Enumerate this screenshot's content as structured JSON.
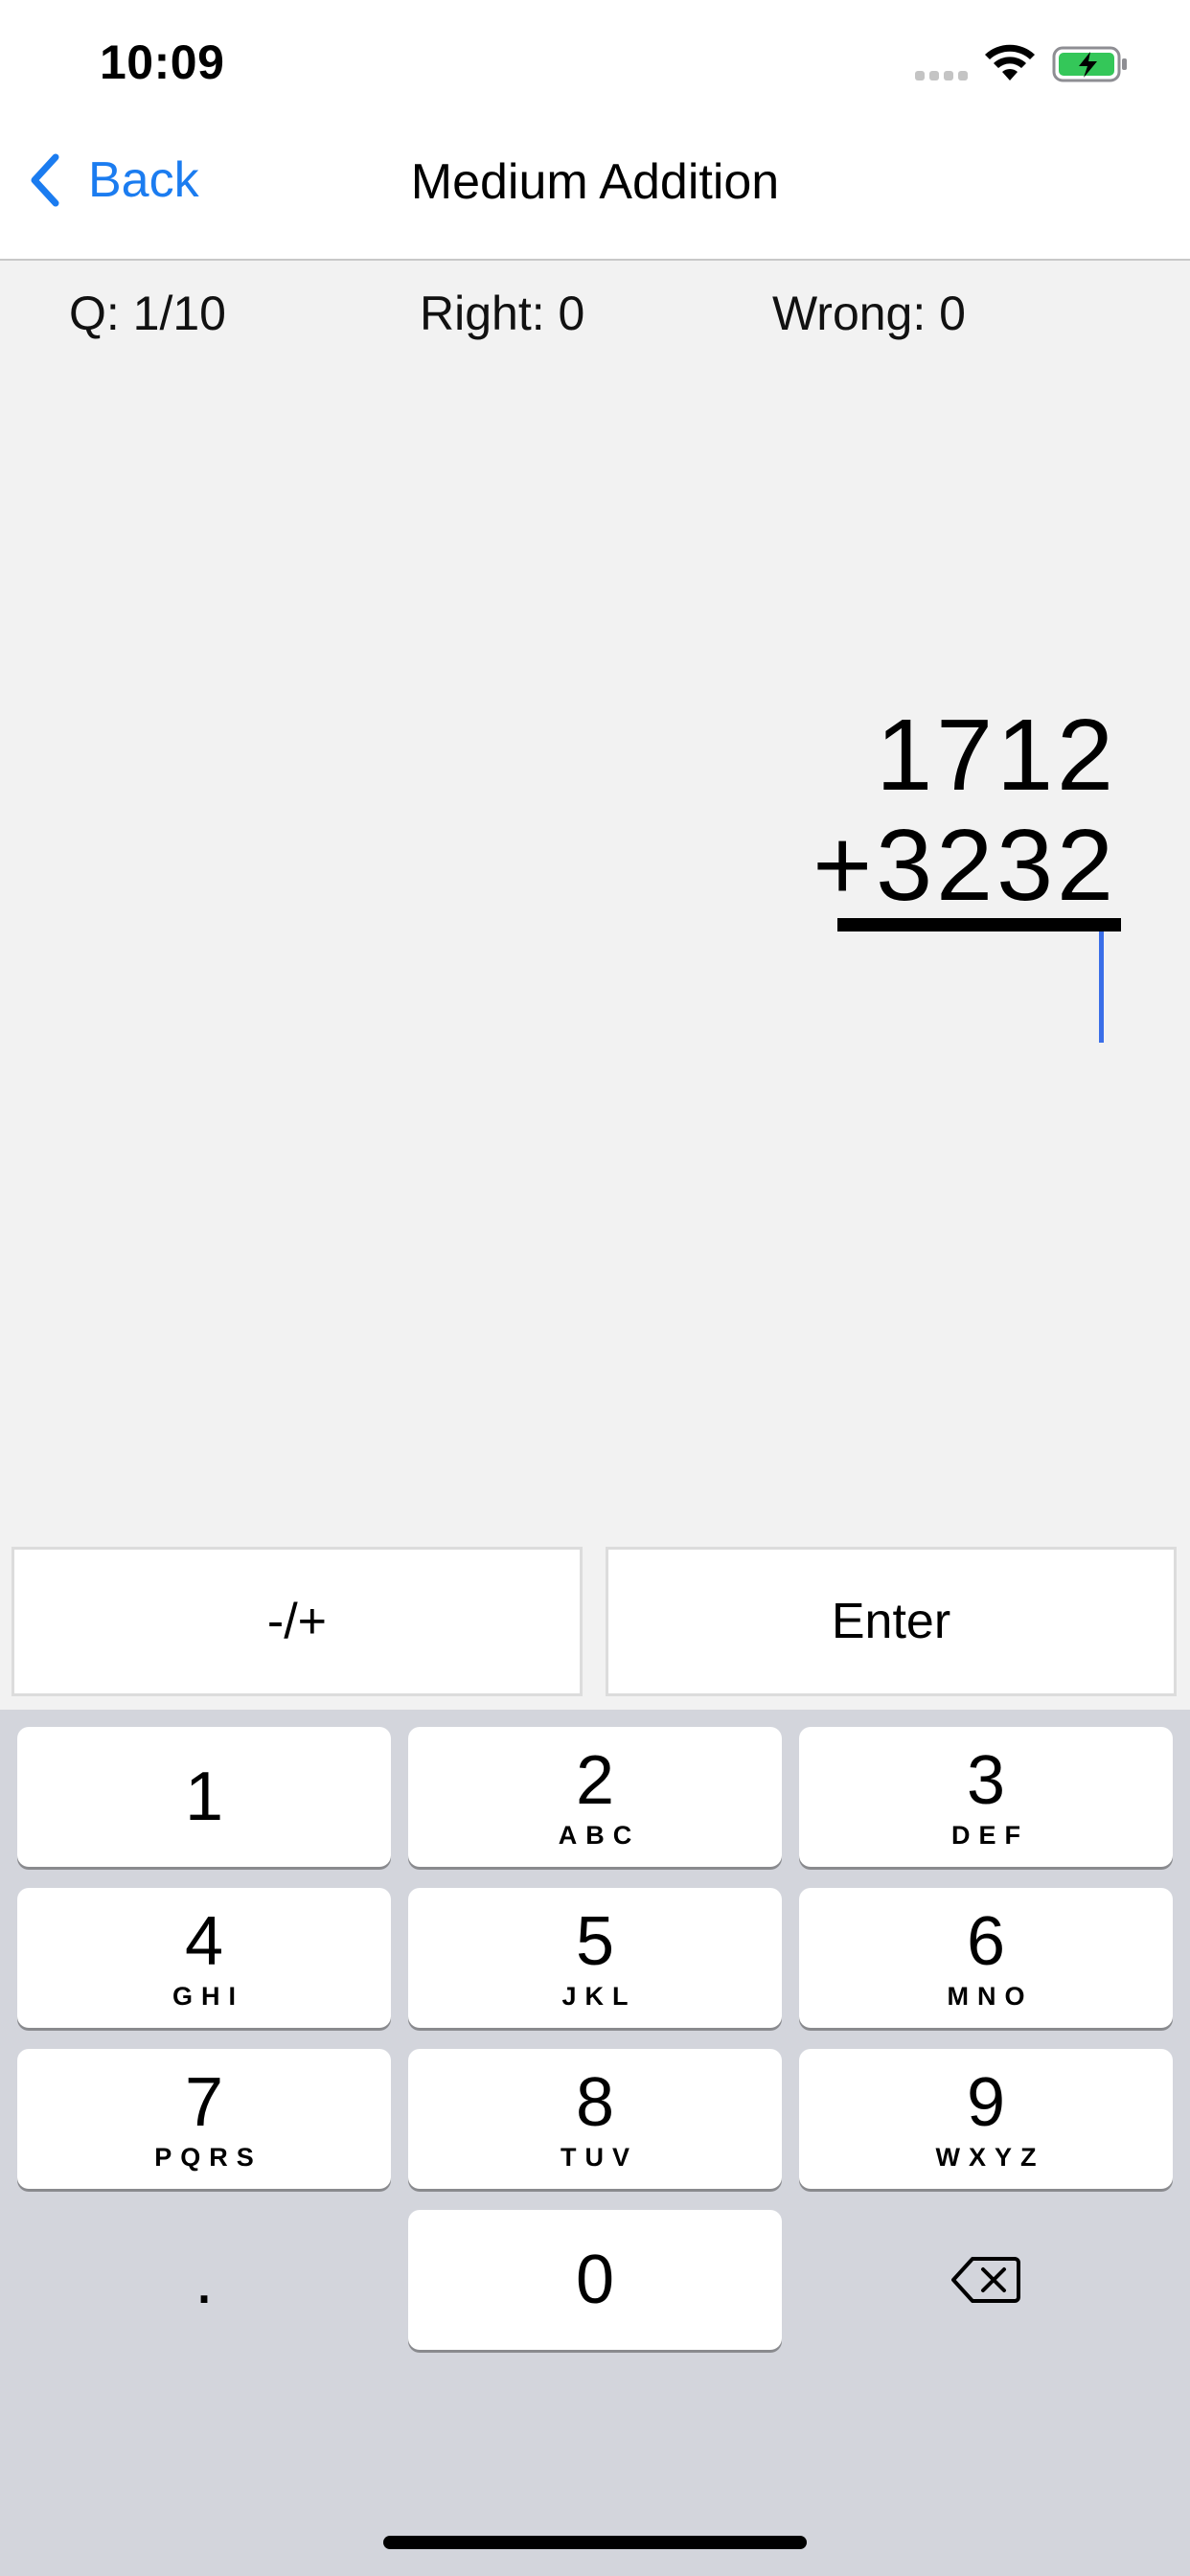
{
  "status_bar": {
    "time": "10:09"
  },
  "nav": {
    "back_label": "Back",
    "title": "Medium Addition"
  },
  "stats": {
    "question": "Q: 1/10",
    "right": "Right: 0",
    "wrong": "Wrong: 0"
  },
  "problem": {
    "operand1": "1712",
    "operand2": "+3232",
    "answer": ""
  },
  "actions": {
    "sign": "-/+",
    "enter": "Enter"
  },
  "keypad": {
    "keys": [
      {
        "digit": "1",
        "letters": ""
      },
      {
        "digit": "2",
        "letters": "ABC"
      },
      {
        "digit": "3",
        "letters": "DEF"
      },
      {
        "digit": "4",
        "letters": "GHI"
      },
      {
        "digit": "5",
        "letters": "JKL"
      },
      {
        "digit": "6",
        "letters": "MNO"
      },
      {
        "digit": "7",
        "letters": "PQRS"
      },
      {
        "digit": "8",
        "letters": "TUV"
      },
      {
        "digit": "9",
        "letters": "WXYZ"
      },
      {
        "digit": ".",
        "letters": ""
      },
      {
        "digit": "0",
        "letters": ""
      }
    ]
  },
  "colors": {
    "accent": "#1b7cf0",
    "battery_fill": "#34c759",
    "cursor": "#3a6ee8"
  },
  "icons": {
    "back": "chevron-left-icon",
    "delete": "backspace-icon",
    "wifi": "wifi-icon",
    "battery": "battery-charging-icon"
  }
}
